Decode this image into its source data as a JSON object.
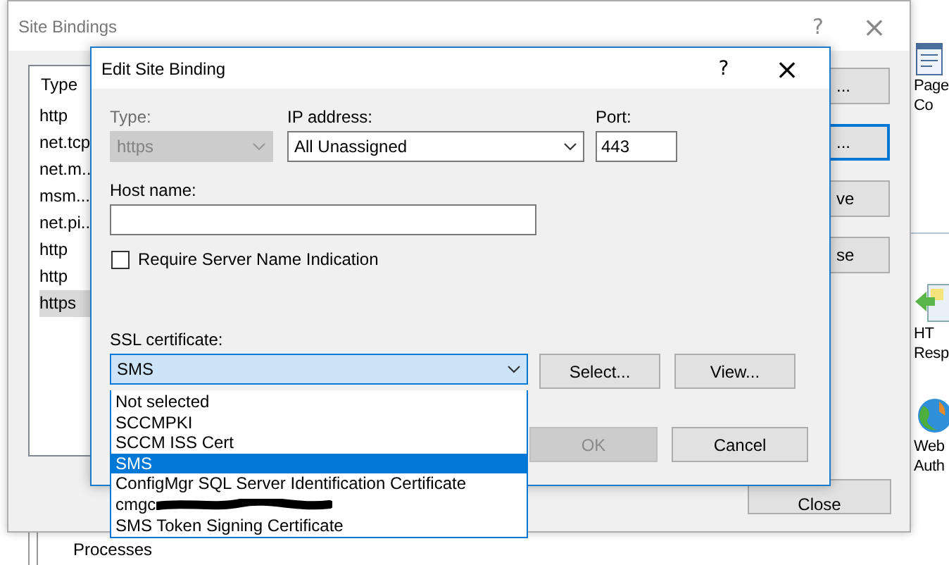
{
  "background": {
    "features": [
      {
        "kind": "page",
        "lines": [
          "Page",
          "Co"
        ]
      },
      {
        "kind": "redirect",
        "lines": [
          "HT",
          "Resp"
        ]
      },
      {
        "kind": "globe",
        "lines": [
          "Web",
          "Auth"
        ]
      }
    ],
    "tree_item": "Processes"
  },
  "site_bindings": {
    "title": "Site Bindings",
    "help": "?",
    "close": "×",
    "list": {
      "header": "Type",
      "items": [
        {
          "label": "http",
          "selected": false
        },
        {
          "label": "net.tcp",
          "selected": false
        },
        {
          "label": "net.m..",
          "selected": false
        },
        {
          "label": "msm...",
          "selected": false
        },
        {
          "label": "net.pi..",
          "selected": false
        },
        {
          "label": "http",
          "selected": false
        },
        {
          "label": "http",
          "selected": false
        },
        {
          "label": "https",
          "selected": true
        }
      ]
    },
    "side_buttons": [
      {
        "label": "...",
        "focused": false
      },
      {
        "label": "...",
        "focused": true
      },
      {
        "label": "ve",
        "focused": false
      },
      {
        "label": "se",
        "focused": false
      }
    ],
    "close_button": "Close"
  },
  "edit_dialog": {
    "title": "Edit Site Binding",
    "help": "?",
    "close": "×",
    "type": {
      "label": "Type:",
      "value": "https",
      "disabled": true
    },
    "ip_address": {
      "label": "IP address:",
      "value": "All Unassigned"
    },
    "port": {
      "label": "Port:",
      "value": "443"
    },
    "host_name": {
      "label": "Host name:"
    },
    "sni": {
      "label": "Require Server Name Indication",
      "checked": false
    },
    "ssl_certificate": {
      "label": "SSL certificate:",
      "value": "SMS",
      "expanded": true,
      "options": [
        {
          "label": "Not selected",
          "selected": false,
          "redacted": false
        },
        {
          "label": "SCCMPKI",
          "selected": false,
          "redacted": false
        },
        {
          "label": "SCCM ISS Cert",
          "selected": false,
          "redacted": false
        },
        {
          "label": "SMS",
          "selected": true,
          "redacted": false
        },
        {
          "label": "ConfigMgr SQL Server Identification Certificate",
          "selected": false,
          "redacted": false
        },
        {
          "label": "cmgc",
          "selected": false,
          "redacted": true
        },
        {
          "label": "SMS Token Signing Certificate",
          "selected": false,
          "redacted": false
        }
      ]
    },
    "select_button": "Select...",
    "view_button": "View...",
    "ok": {
      "label": "OK",
      "disabled": true
    },
    "cancel": "Cancel"
  }
}
